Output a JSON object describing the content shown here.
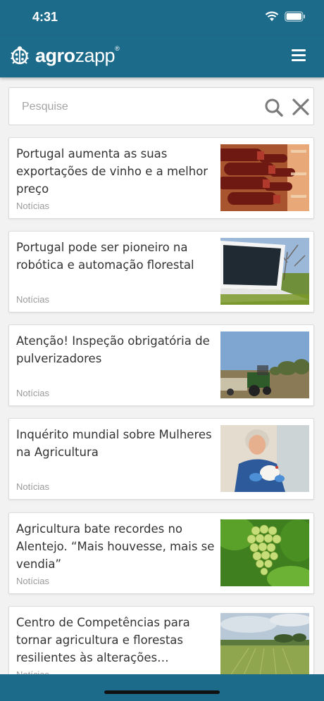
{
  "status_bar": {
    "time": "4:31"
  },
  "app_bar": {
    "logo_bold": "agro",
    "logo_light": "zapp",
    "logo_mark": "®",
    "menu_icon": "hamburger-menu-icon"
  },
  "search": {
    "placeholder": "Pesquise",
    "value": ""
  },
  "articles": [
    {
      "title": "Portugal aumenta as suas exportações de vinho e a melhor preço",
      "category": "Notícias",
      "image": "wine-bottles-photo"
    },
    {
      "title": "Portugal pode ser pioneiro na robótica e automação florestal",
      "category": "Notícias",
      "image": "laptop-outdoors-photo"
    },
    {
      "title": "Atenção! Inspeção obrigatória de pulverizadores",
      "category": "Notícias",
      "image": "tractor-sprayer-photo"
    },
    {
      "title": "Inquérito mundial sobre Mulheres na Agricultura",
      "category": "Notícias",
      "image": "woman-with-chicken-photo"
    },
    {
      "title": "Agricultura bate recordes no Alentejo. “Mais houvesse, mais se vendia”",
      "category": "Notícias",
      "image": "grapes-photo"
    },
    {
      "title": "Centro de Competências para tornar agricultura e florestas resilientes às alterações…",
      "category": "Notícias",
      "image": "wheat-field-photo"
    }
  ],
  "colors": {
    "brand": "#1d6b8a",
    "background": "#f2f2f2"
  }
}
